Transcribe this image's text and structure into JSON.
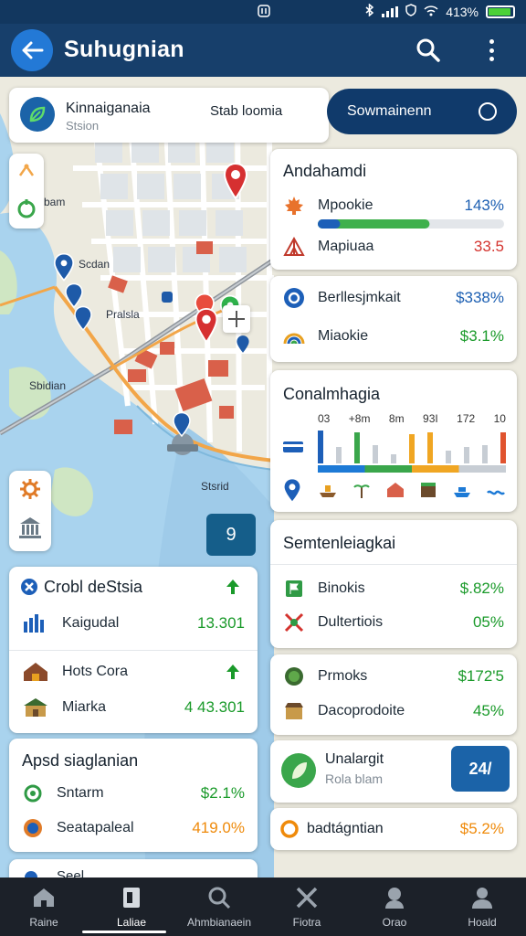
{
  "status_bar": {
    "center_icon": "nfc-icon",
    "battery_text": "413%"
  },
  "app_bar": {
    "title": "Suhugnian"
  },
  "map": {
    "labels": [
      "bam",
      "Scdan",
      "Pralsla",
      "Sbidian",
      "Stsrid"
    ],
    "locate_button": "9"
  },
  "search_card": {
    "title": "Kinnaiganaia",
    "subtitle": "Stsion",
    "right_text": "Stab loomia"
  },
  "primary_button": {
    "label": "Sowmainenn"
  },
  "card_a": {
    "title": "Andahamdi",
    "rows": [
      {
        "icon": "maple-leaf-icon",
        "name": "Mpookie",
        "value": "143%"
      },
      {
        "icon": "tent-icon",
        "name": "Mapiuaa",
        "value": "33.5"
      }
    ],
    "progress": 0.6
  },
  "card_b": {
    "rows": [
      {
        "icon": "circle-o-icon",
        "name": "Berllesjmkait",
        "value": "$338%"
      },
      {
        "icon": "rainbow-icon",
        "name": "Miaokie",
        "value": "$3.1%"
      }
    ]
  },
  "card_c": {
    "title": "Conalmhagia",
    "ticks": [
      "03",
      "+8m",
      "8m",
      "93I",
      "172",
      "10"
    ],
    "bar_values": [
      0.9,
      0.45,
      0.85,
      0.5,
      0.25,
      0.8,
      0.85,
      0.35,
      0.45,
      0.5,
      0.85
    ],
    "bar_colors": [
      "#1d5fb8",
      "#c7cdd4",
      "#3aa64b",
      "#c7cdd4",
      "#c7cdd4",
      "#f0a623",
      "#f0a623",
      "#c7cdd4",
      "#c7cdd4",
      "#c7cdd4",
      "#e0532e"
    ],
    "segment_colors": [
      "#1d7ad6",
      "#3aa64b",
      "#f0a623",
      "#c7cdd4"
    ]
  },
  "card_d": {
    "title": "Crobl deStsia",
    "rows": [
      {
        "icon": "bars-building-icon",
        "name": "Kaigudal",
        "value": "13.301"
      },
      {
        "icon": "house-icon",
        "name": "Hots Cora",
        "value": ""
      },
      {
        "icon": "hut-icon",
        "name": "Miarka",
        "value": "4 43.301"
      }
    ]
  },
  "card_e": {
    "title": "Semtenleiagkai",
    "rows": [
      {
        "icon": "flag-icon",
        "name": "Binokis",
        "value": "$.82%"
      },
      {
        "icon": "sports-icon",
        "name": "Dultertiois",
        "value": "05%"
      }
    ]
  },
  "card_f": {
    "title": "Apsd siaglanian",
    "rows": [
      {
        "icon": "pin-outline-icon",
        "name": "Sntarm",
        "value": "$2.1%"
      },
      {
        "icon": "badge-icon",
        "name": "Seatapaleal",
        "value": "419.0%"
      }
    ]
  },
  "card_g": {
    "rows": [
      {
        "icon": "globe-icon",
        "name": "Prmoks",
        "value": "$172'5"
      },
      {
        "icon": "market-icon",
        "name": "Dacoprodoite",
        "value": "45%"
      }
    ]
  },
  "card_h": {
    "name": "Unalargit",
    "sub": "Rola blam",
    "badge": "24/"
  },
  "card_i": {
    "name": "badtágntian",
    "value": "$5.2%"
  },
  "card_j": {
    "label": "Seel"
  },
  "bottom_nav": [
    {
      "icon": "home-icon",
      "label": "Raine"
    },
    {
      "icon": "document-icon",
      "label": "Laliae"
    },
    {
      "icon": "search-icon",
      "label": "Ahmbianaein"
    },
    {
      "icon": "tools-icon",
      "label": "Fiotra"
    },
    {
      "icon": "person-icon",
      "label": "Orao"
    },
    {
      "icon": "user-icon",
      "label": "Hoald"
    }
  ]
}
